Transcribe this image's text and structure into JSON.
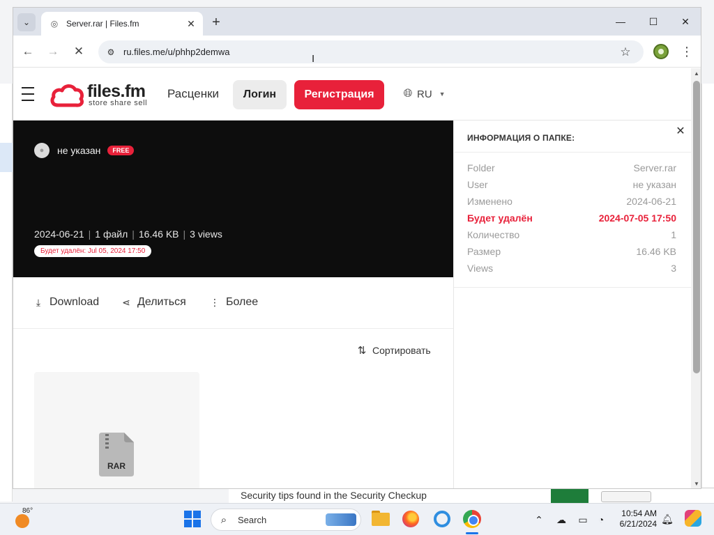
{
  "browser": {
    "tab_title": "Server.rar | Files.fm",
    "url": "ru.files.me/u/phhp2demwa",
    "window_controls": {
      "minimize": "—",
      "maximize": "☐",
      "close": "✕"
    }
  },
  "site": {
    "logo_name": "files.fm",
    "logo_tagline": "store share sell",
    "nav_pricing": "Расценки",
    "login_label": "Логин",
    "register_label": "Регистрация",
    "language": "RU",
    "accent_color": "#e8213a"
  },
  "hero": {
    "owner": "не указан",
    "plan_badge": "FREE",
    "date": "2024-06-21",
    "file_count": "1 файл",
    "size": "16.46 KB",
    "views": "3 views",
    "expiry_notice": "Будет удалён: Jul 05, 2024 17:50"
  },
  "actions": {
    "download": "Download",
    "share": "Делиться",
    "more": "Более"
  },
  "sort_label": "Сортировать",
  "file": {
    "type_label": "RAR"
  },
  "info_panel": {
    "title": "ИНФОРМАЦИЯ О ПАПКЕ:",
    "rows": [
      {
        "label": "Folder",
        "value": "Server.rar"
      },
      {
        "label": "User",
        "value": "не указан"
      },
      {
        "label": "Изменено",
        "value": "2024-06-21"
      },
      {
        "label": "Будет удалён",
        "value": "2024-07-05 17:50"
      },
      {
        "label": "Количество",
        "value": "1"
      },
      {
        "label": "Размер",
        "value": "16.46 KB"
      },
      {
        "label": "Views",
        "value": "3"
      }
    ]
  },
  "background_window": {
    "text": "Security tips found in the Security Checkup"
  },
  "taskbar": {
    "temperature": "86°",
    "search_placeholder": "Search",
    "time": "10:54 AM",
    "date": "6/21/2024"
  }
}
